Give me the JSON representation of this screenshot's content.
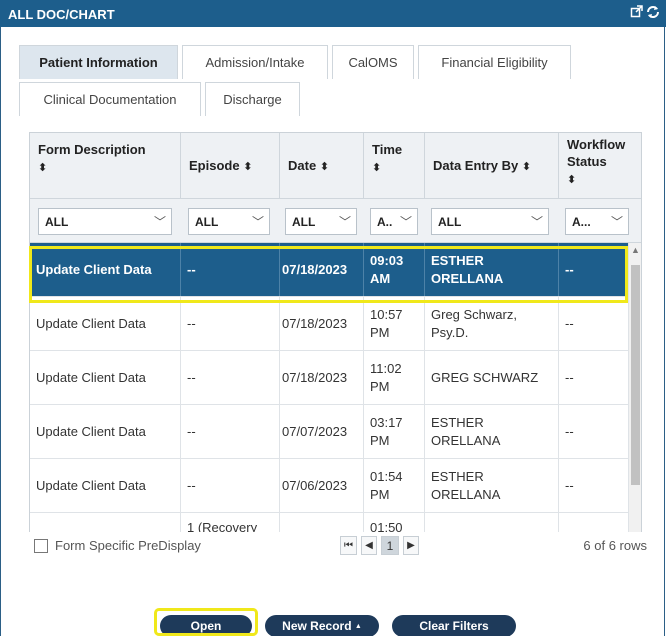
{
  "window": {
    "title": "ALL DOC/CHART"
  },
  "tabs_row1": [
    {
      "label": "Patient Information",
      "active": true
    },
    {
      "label": "Admission/Intake",
      "active": false
    },
    {
      "label": "CalOMS",
      "active": false
    },
    {
      "label": "Financial Eligibility",
      "active": false
    }
  ],
  "tabs_row2": [
    {
      "label": "Clinical Documentation",
      "active": false
    },
    {
      "label": "Discharge",
      "active": false
    }
  ],
  "grid": {
    "columns": [
      {
        "label": "Form Description",
        "sort": "⬍"
      },
      {
        "label": "Episode",
        "sort": "⬍"
      },
      {
        "label": "Date",
        "sort": "⬍"
      },
      {
        "label": "Time",
        "sort": "⬍"
      },
      {
        "label": "Data Entry By",
        "sort": "⬍"
      },
      {
        "label": "Workflow Status",
        "sort": "⬍"
      }
    ],
    "filters": [
      "ALL",
      "ALL",
      "ALL",
      "A..",
      "ALL",
      "A..."
    ],
    "rows": [
      {
        "form": "Update Client Data",
        "episode": "--",
        "date": "07/18/2023",
        "time": "09:03 AM",
        "entry": "ESTHER ORELLANA",
        "status": "--",
        "selected": true
      },
      {
        "form": "Update Client Data",
        "episode": "--",
        "date": "07/18/2023",
        "time": "10:57 PM",
        "entry": "Greg Schwarz, Psy.D.",
        "status": "--",
        "selected": false
      },
      {
        "form": "Update Client Data",
        "episode": "--",
        "date": "07/18/2023",
        "time": "11:02 PM",
        "entry": "GREG SCHWARZ",
        "status": "--",
        "selected": false
      },
      {
        "form": "Update Client Data",
        "episode": "--",
        "date": "07/07/2023",
        "time": "03:17 PM",
        "entry": "ESTHER ORELLANA",
        "status": "--",
        "selected": false
      },
      {
        "form": "Update Client Data",
        "episode": "--",
        "date": "07/06/2023",
        "time": "01:54 PM",
        "entry": "ESTHER ORELLANA",
        "status": "--",
        "selected": false
      },
      {
        "form": "",
        "episode": "1 (Recovery",
        "date": "",
        "time": "01:50",
        "entry": "",
        "status": "",
        "selected": false
      }
    ]
  },
  "footer": {
    "checkbox_label": "Form Specific PreDisplay",
    "pager": {
      "first": "⏮",
      "prev": "◀",
      "page": "1",
      "next": "▶"
    },
    "row_count": "6 of 6 rows"
  },
  "actions": {
    "open_label": "Open",
    "new_record_label": "New Record",
    "new_record_caret": "▲",
    "clear_filters_label": "Clear Filters"
  },
  "colors": {
    "header": "#1d5e8c",
    "selected_row": "#1d5e8c",
    "highlight": "#f0e81a",
    "button": "#1e3a5a"
  }
}
